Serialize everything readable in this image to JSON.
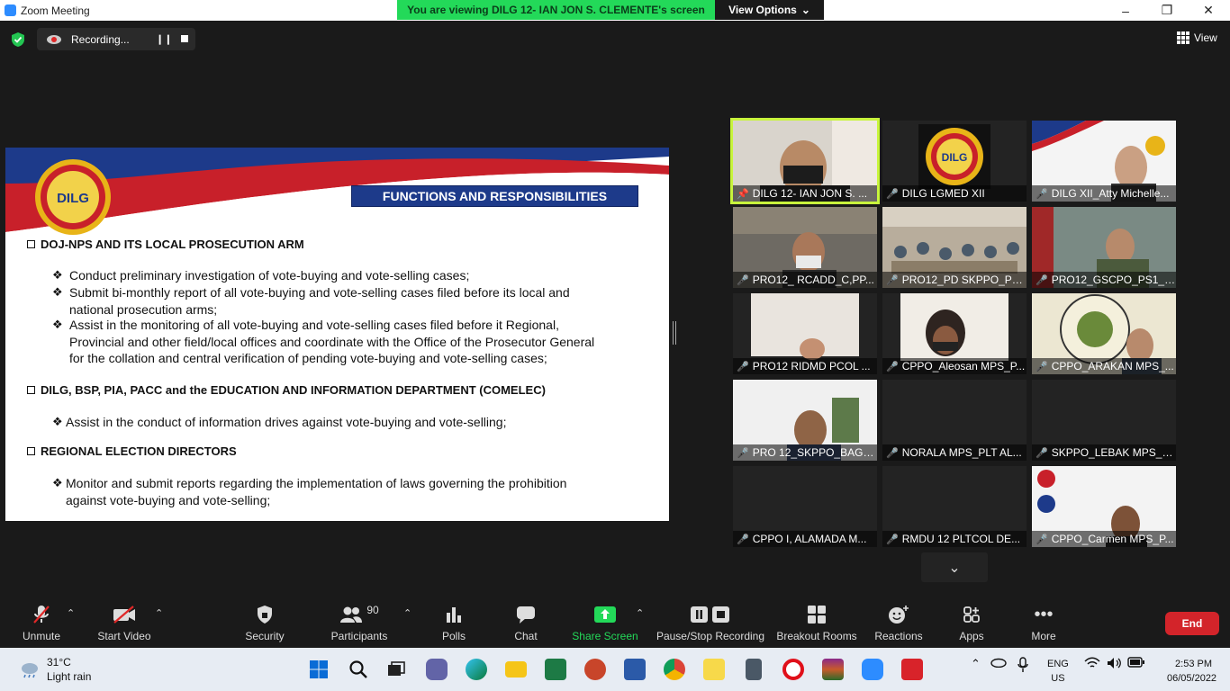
{
  "window": {
    "title": "Zoom Meeting"
  },
  "banner": {
    "text": "You are viewing DILG 12- IAN JON S. CLEMENTE's screen",
    "view_options": "View Options"
  },
  "recording": {
    "status": "Recording..."
  },
  "view": {
    "label": "View"
  },
  "slide": {
    "logo_text": "DILG",
    "heading": "FUNCTIONS AND RESPONSIBILITIES",
    "sections": [
      {
        "title": "DOJ-NPS AND ITS LOCAL PROSECUTION ARM",
        "bullets": [
          {
            "lines": [
              "Conduct preliminary investigation of vote-buying and vote-selling cases;"
            ]
          },
          {
            "lines": [
              "Submit bi-monthly report of all vote-buying and vote-selling cases filed before its local and",
              "national prosecution arms;"
            ]
          },
          {
            "lines": [
              "Assist in the monitoring of all vote-buying and vote-selling cases filed before it Regional,",
              "Provincial and other field/local offices and coordinate with the Office of the Prosecutor General",
              "for the collation and central verification of pending vote-buying and vote-selling cases;"
            ]
          }
        ]
      },
      {
        "title": "DILG, BSP, PIA, PACC and the EDUCATION AND INFORMATION DEPARTMENT (COMELEC)",
        "bullets": [
          {
            "lines": [
              "Assist in the conduct of information drives against vote-buying and vote-selling;"
            ]
          }
        ]
      },
      {
        "title": "REGIONAL ELECTION DIRECTORS",
        "bullets": [
          {
            "lines": [
              "Monitor and submit reports regarding the implementation of laws governing the prohibition",
              "against vote-buying and vote-selling;"
            ]
          }
        ]
      }
    ]
  },
  "participants_grid": [
    {
      "name": "DILG 12- IAN JON S. ...",
      "active": true,
      "muted": false
    },
    {
      "name": "DILG LGMED XII",
      "active": false,
      "muted": true
    },
    {
      "name": "DILG XII_Atty Michelle...",
      "active": false,
      "muted": true
    },
    {
      "name": "PRO12_ RCADD_C,PP...",
      "active": false,
      "muted": true
    },
    {
      "name": "PRO12_PD SKPPO_PC...",
      "active": false,
      "muted": true
    },
    {
      "name": "PRO12_GSCPO_PS1_P...",
      "active": false,
      "muted": true
    },
    {
      "name": "PRO12 RIDMD PCOL ...",
      "active": false,
      "muted": true
    },
    {
      "name": "CPPO_Aleosan MPS_P...",
      "active": false,
      "muted": true
    },
    {
      "name": "CPPO_ARAKAN MPS_...",
      "active": false,
      "muted": true
    },
    {
      "name": "PRO 12_SKPPO_BAGU...",
      "active": false,
      "muted": true
    },
    {
      "name": "NORALA MPS_PLT AL...",
      "active": false,
      "muted": true
    },
    {
      "name": "SKPPO_LEBAK MPS_P...",
      "active": false,
      "muted": true
    },
    {
      "name": "CPPO I, ALAMADA M...",
      "active": false,
      "muted": true
    },
    {
      "name": "RMDU 12 PLTCOL DE...",
      "active": false,
      "muted": true
    },
    {
      "name": "CPPO_Carmen MPS_P...",
      "active": false,
      "muted": true
    }
  ],
  "toolbar": {
    "unmute": "Unmute",
    "start_video": "Start Video",
    "security": "Security",
    "participants": "Participants",
    "participants_count": "90",
    "polls": "Polls",
    "chat": "Chat",
    "share_screen": "Share Screen",
    "pause_stop_recording": "Pause/Stop Recording",
    "breakout_rooms": "Breakout Rooms",
    "reactions": "Reactions",
    "apps": "Apps",
    "more": "More",
    "end": "End"
  },
  "taskbar": {
    "weather_temp": "31°C",
    "weather_cond": "Light rain",
    "lang": "ENG",
    "region": "US",
    "time": "2:53 PM",
    "date": "06/05/2022"
  },
  "colors": {
    "share_green": "#23d959",
    "end_red": "#d3242a",
    "active_border": "#c8f53c",
    "slide_heading_blue": "#1d3a8a"
  }
}
